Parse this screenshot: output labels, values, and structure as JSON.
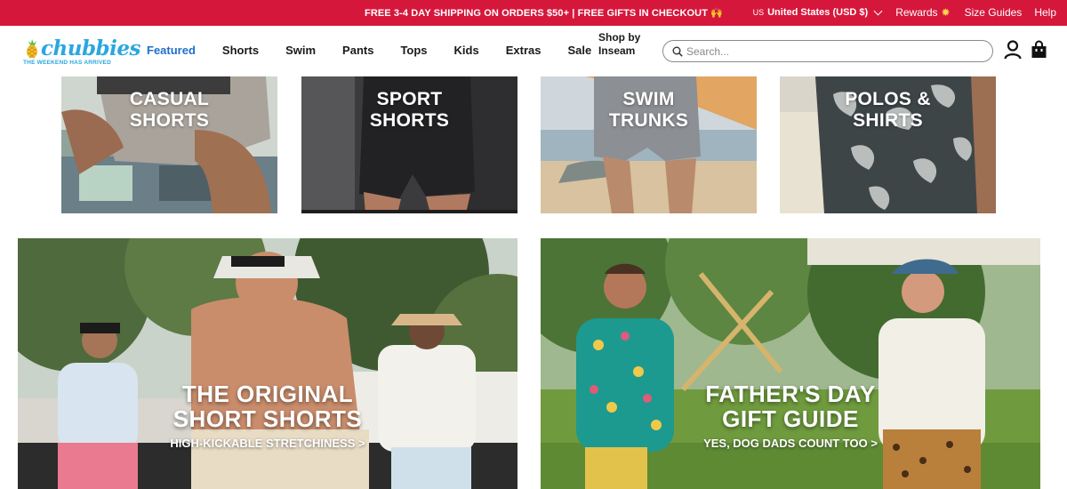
{
  "promo": {
    "message": "FREE 3-4 DAY SHIPPING ON ORDERS $50+ | FREE GIFTS IN CHECKOUT 🙌",
    "currency_flag": "US",
    "currency_label": "United States (USD $)",
    "rewards": "Rewards",
    "size_guides": "Size Guides",
    "help": "Help"
  },
  "logo": {
    "wordmark": "chubbies",
    "tagline": "THE WEEKEND HAS ARRIVED"
  },
  "nav": {
    "items": [
      {
        "label": "Featured",
        "active": true
      },
      {
        "label": "Shorts"
      },
      {
        "label": "Swim"
      },
      {
        "label": "Pants"
      },
      {
        "label": "Tops"
      },
      {
        "label": "Kids"
      },
      {
        "label": "Extras"
      },
      {
        "label": "Sale"
      }
    ],
    "shop_by": "Shop by Inseam"
  },
  "search": {
    "placeholder": "Search..."
  },
  "icons": {
    "search": "search-icon",
    "account": "account-icon",
    "cart": "cart-icon",
    "currency_chevron": "chevron-down-icon",
    "rewards": "sun-icon"
  },
  "categories": [
    {
      "line1": "CASUAL",
      "line2": "SHORTS"
    },
    {
      "line1": "SPORT",
      "line2": "SHORTS"
    },
    {
      "line1": "SWIM",
      "line2": "TRUNKS"
    },
    {
      "line1": "POLOS &",
      "line2": "SHIRTS"
    }
  ],
  "banners": [
    {
      "line1": "THE ORIGINAL",
      "line2": "SHORT SHORTS",
      "cta": "HIGH-KICKABLE STRETCHINESS >"
    },
    {
      "line1": "FATHER'S DAY",
      "line2": "GIFT GUIDE",
      "cta": "YES, DOG DADS COUNT TOO >"
    }
  ],
  "colors": {
    "promo_bg": "#d6173c",
    "nav_active": "#1f6fc9",
    "logo": "#2aa7e0"
  }
}
